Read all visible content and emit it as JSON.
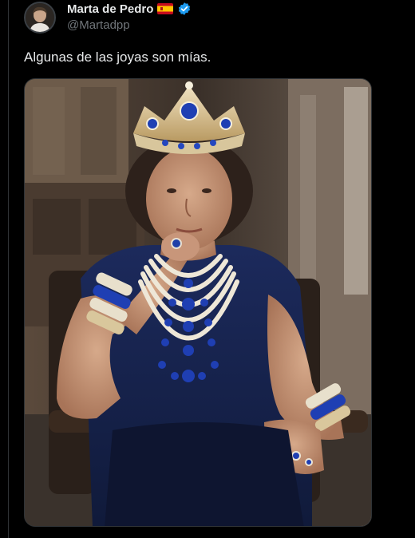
{
  "user": {
    "display_name": "Marta de Pedro",
    "handle": "@Martadpp",
    "flag_icon": "spain-flag-icon",
    "verified_icon": "verified-badge-icon",
    "verified_color": "#1d9bf0"
  },
  "tweet": {
    "text": "Algunas de las joyas son mías."
  },
  "colors": {
    "background": "#000000",
    "text_primary": "#e7e9ea",
    "text_secondary": "#71767b",
    "border": "#2f3336"
  }
}
